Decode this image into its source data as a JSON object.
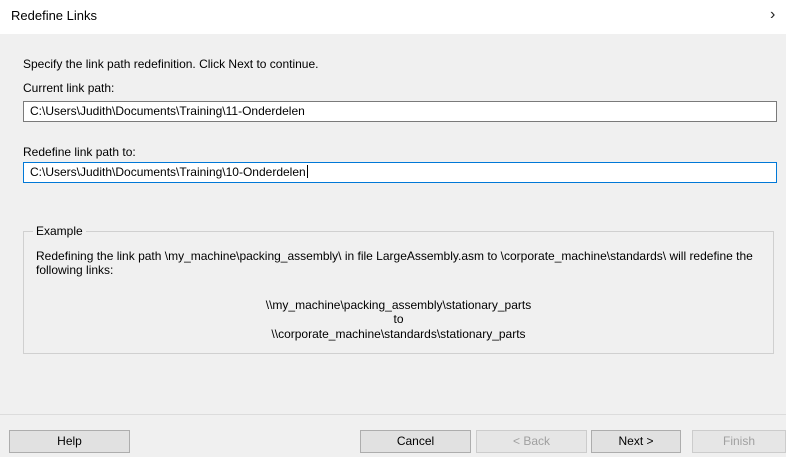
{
  "window": {
    "title": "Redefine Links",
    "chevron_glyph": "›"
  },
  "main": {
    "instruction": "Specify the link path redefinition. Click Next to continue.",
    "current_label": "Current link path:",
    "current_value": "C:\\Users\\Judith\\Documents\\Training\\11-Onderdelen",
    "redefine_label": "Redefine link path to:",
    "redefine_value": "C:\\Users\\Judith\\Documents\\Training\\10-Onderdelen"
  },
  "example": {
    "legend": "Example",
    "description": "Redefining the link path \\my_machine\\packing_assembly\\ in file LargeAssembly.asm to \\corporate_machine\\standards\\ will redefine the following links:",
    "source": "\\\\my_machine\\packing_assembly\\stationary_parts",
    "to": "to",
    "destination": "\\\\corporate_machine\\standards\\stationary_parts"
  },
  "buttons": {
    "help": "Help",
    "cancel": "Cancel",
    "back": "< Back",
    "next": "Next >",
    "finish": "Finish"
  }
}
